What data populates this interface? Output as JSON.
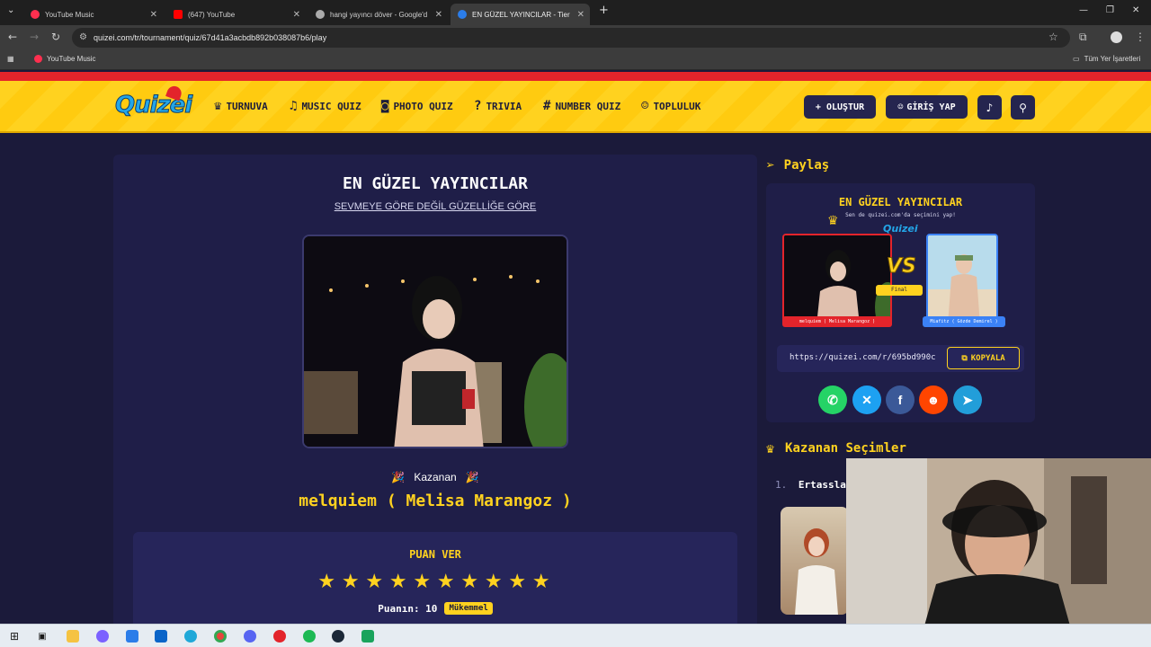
{
  "browser": {
    "tabs": [
      {
        "label": "YouTube Music",
        "fav_color": "#ff2f4f"
      },
      {
        "label": "(647) YouTube",
        "fav_color": "#ff0000"
      },
      {
        "label": "hangi yayıncı döver - Google'd",
        "fav_color": "#aaaaaa"
      },
      {
        "label": "EN GÜZEL YAYINCILAR - Tier Li",
        "fav_color": "#2b7de9"
      }
    ],
    "url": "quizei.com/tr/tournament/quiz/67d41a3acbdb892b038087b6/play",
    "bookmark": "YouTube Music",
    "all_bookmarks": "Tüm Yer İşaretleri"
  },
  "site": {
    "logo": "Quizei",
    "menu": [
      {
        "label": "TURNUVA",
        "icon": "trophy-icon",
        "glyph": "♛"
      },
      {
        "label": "MUSIC QUIZ",
        "icon": "music-icon",
        "glyph": "♫"
      },
      {
        "label": "PHOTO QUIZ",
        "icon": "camera-icon",
        "glyph": "◙"
      },
      {
        "label": "TRIVIA",
        "icon": "question-icon",
        "glyph": "?"
      },
      {
        "label": "NUMBER QUIZ",
        "icon": "hash-icon",
        "glyph": "#"
      },
      {
        "label": "TOPLULUK",
        "icon": "users-icon",
        "glyph": "☺"
      }
    ],
    "create_label": "+ OLUŞTUR",
    "login_label": "GİRİŞ YAP"
  },
  "quiz": {
    "title": "EN GÜZEL YAYINCILAR",
    "subtitle": "SEVMEYE GÖRE DEĞİL GÜZELLİĞE GÖRE",
    "winner_label": "Kazanan",
    "winner_name": "melquiem ( Melisa Marangoz )",
    "rate_title": "PUAN VER",
    "stars_total": 10,
    "stars_filled": 10,
    "score_label": "Puanın: 10",
    "score_badge": "Mükemmel"
  },
  "share": {
    "heading": "Paylaş",
    "card_title": "EN GÜZEL YAYINCILAR",
    "card_sub": "Sen de quizei.com'da seçimini yap!",
    "card_logo": "Quizei",
    "left_tag": "melquiem ( Melisa Marangoz )",
    "right_tag": "Miafitz ( Gözde Demirel )",
    "vs": "VS",
    "final": "Final",
    "link": "https://quizei.com/r/695bd990c",
    "copy_label": "KOPYALA"
  },
  "winners": {
    "heading": "Kazanan Seçimler",
    "rank": "1.",
    "first": "Ertassla"
  },
  "colors": {
    "accent": "#ffd21f",
    "bg": "#1b1a3a",
    "card": "#1f1e48"
  }
}
